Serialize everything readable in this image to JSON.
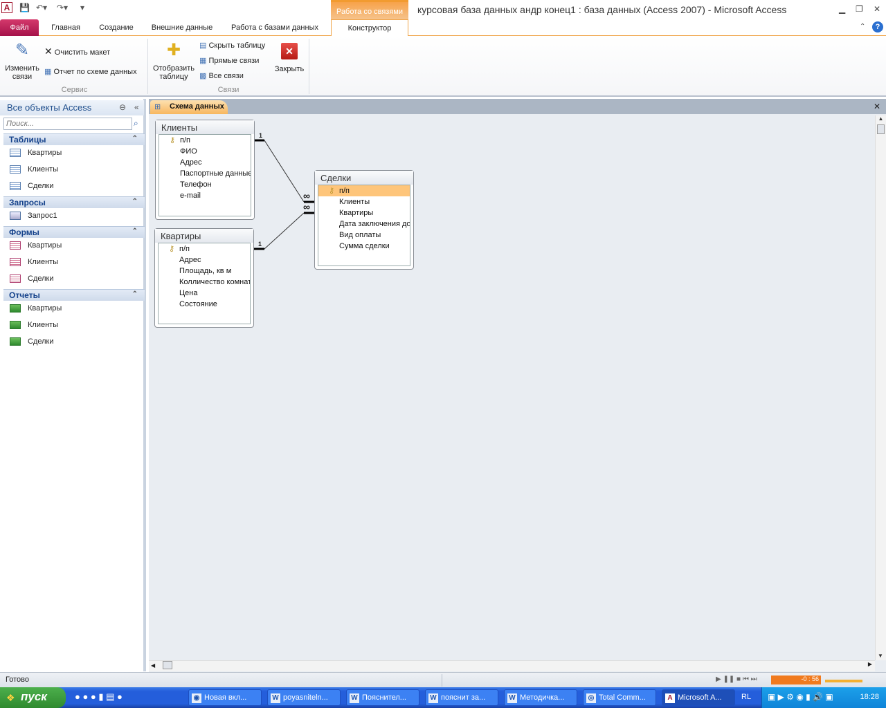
{
  "app": {
    "title": "курсовая база данных андр конец1 : база данных (Access 2007)  -  Microsoft Access",
    "context_tab": "Работа со связями"
  },
  "ribbon": {
    "tabs": [
      "Файл",
      "Главная",
      "Создание",
      "Внешние данные",
      "Работа с базами данных",
      "Конструктор"
    ],
    "groups": {
      "service": {
        "label": "Сервис",
        "edit": "Изменить связи",
        "clear": "Очистить макет",
        "report": "Отчет по схеме данных"
      },
      "links": {
        "label": "Связи",
        "show": "Отобразить таблицу",
        "hide": "Скрыть таблицу",
        "direct": "Прямые связи",
        "all": "Все связи",
        "close": "Закрыть"
      }
    }
  },
  "nav": {
    "title": "Все объекты Access",
    "search_placeholder": "Поиск...",
    "groups": [
      {
        "label": "Таблицы",
        "items": [
          "Квартиры",
          "Клиенты",
          "Сделки"
        ]
      },
      {
        "label": "Запросы",
        "items": [
          "Запрос1"
        ]
      },
      {
        "label": "Формы",
        "items": [
          "Квартиры",
          "Клиенты",
          "Сделки"
        ]
      },
      {
        "label": "Отчеты",
        "items": [
          "Квартиры",
          "Клиенты",
          "Сделки"
        ]
      }
    ]
  },
  "doc": {
    "tab": "Схема данных",
    "tables": [
      {
        "name": "Клиенты",
        "fields": [
          "п/п",
          "ФИО",
          "Адрес",
          "Паспортные данные",
          "Телефон",
          "e-mail"
        ]
      },
      {
        "name": "Квартиры",
        "fields": [
          "п/п",
          "Адрес",
          "Площадь, кв м",
          "Колличество комнат",
          "Цена",
          "Состояние"
        ]
      },
      {
        "name": "Сделки",
        "fields": [
          "п/п",
          "Клиенты",
          "Квартиры",
          "Дата заключения до",
          "Вид оплаты",
          "Сумма сделки"
        ]
      }
    ],
    "relations": [
      {
        "one": "1",
        "many": "∞"
      },
      {
        "one": "1",
        "many": "∞"
      }
    ]
  },
  "status": {
    "text": "Готово",
    "media": "-0 : 56"
  },
  "taskbar": {
    "start": "пуск",
    "items": [
      "Новая вкл...",
      "poyasniteln...",
      "Пояснител...",
      "пояснит за...",
      "Методичка...",
      "Total Comm...",
      "Microsoft A..."
    ],
    "lang": "RL",
    "clock": "18:28"
  }
}
